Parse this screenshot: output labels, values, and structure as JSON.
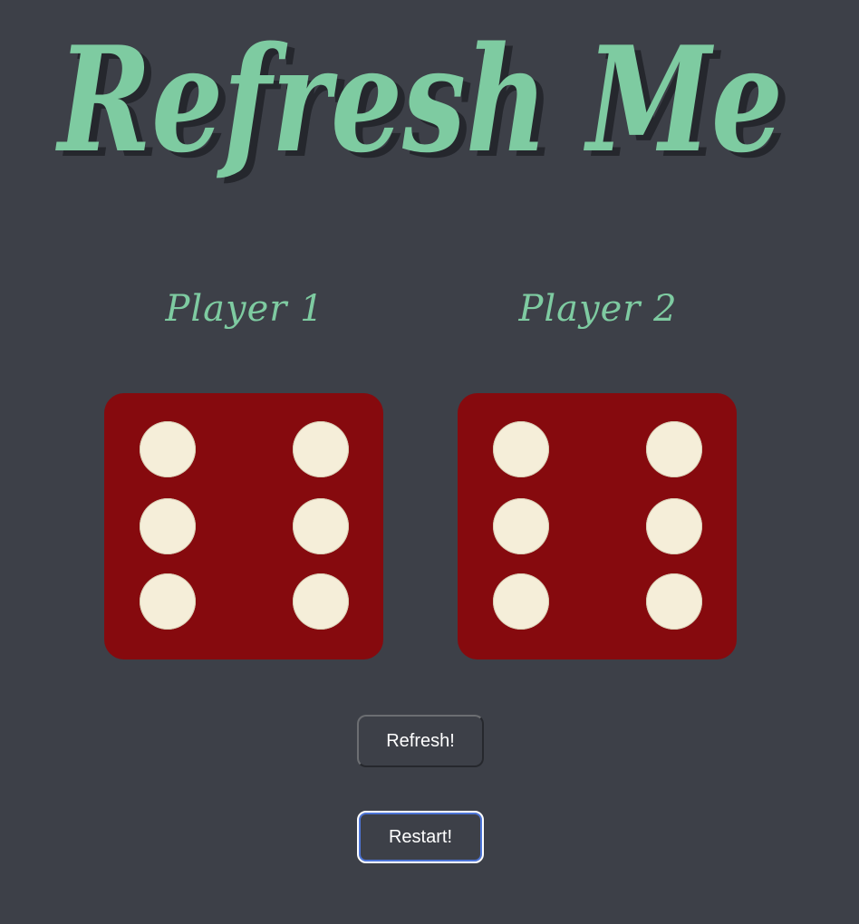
{
  "title": "Refresh Me",
  "players": [
    {
      "label": "Player 1",
      "die_value": 6
    },
    {
      "label": "Player 2",
      "die_value": 6
    }
  ],
  "buttons": {
    "refresh_label": "Refresh!",
    "restart_label": "Restart!"
  },
  "colors": {
    "background": "#3d4048",
    "accent": "#7ecba1",
    "die": "#860a0e",
    "pip": "#f5eed9"
  }
}
